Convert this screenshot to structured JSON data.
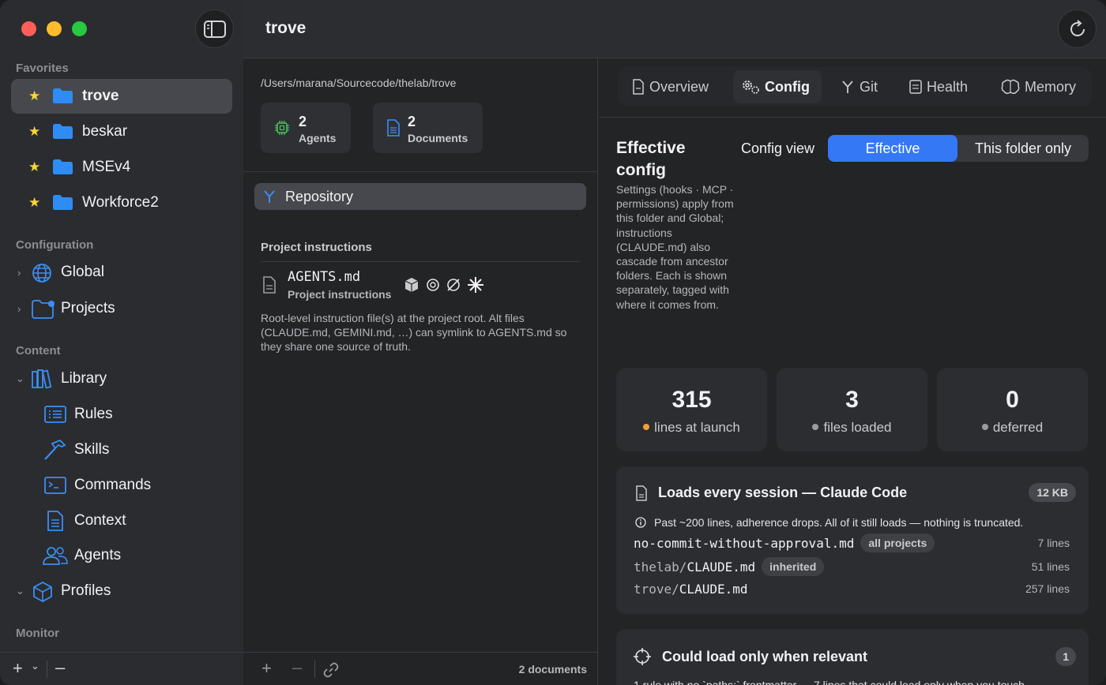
{
  "window": {
    "title": "trove"
  },
  "sidebar": {
    "favorites_header": "Favorites",
    "favorites": [
      {
        "label": "trove",
        "selected": true
      },
      {
        "label": "beskar",
        "selected": false
      },
      {
        "label": "MSEv4",
        "selected": false
      },
      {
        "label": "Workforce2",
        "selected": false
      }
    ],
    "configuration_header": "Configuration",
    "configuration": [
      {
        "label": "Global",
        "icon": "globe-icon"
      },
      {
        "label": "Projects",
        "icon": "folder-gear-icon"
      }
    ],
    "content_header": "Content",
    "library_label": "Library",
    "library_items": [
      {
        "label": "Rules",
        "icon": "list-icon"
      },
      {
        "label": "Skills",
        "icon": "hammer-icon"
      },
      {
        "label": "Commands",
        "icon": "terminal-icon"
      },
      {
        "label": "Context",
        "icon": "document-icon"
      },
      {
        "label": "Agents",
        "icon": "people-icon"
      }
    ],
    "profiles_label": "Profiles",
    "monitor_header": "Monitor"
  },
  "middle": {
    "path": "/Users/marana/Sourcecode/thelab/trove",
    "stats": [
      {
        "value": "2",
        "label": "Agents"
      },
      {
        "value": "2",
        "label": "Documents"
      }
    ],
    "repository_label": "Repository",
    "project_instructions_title": "Project instructions",
    "agents_file": "AGENTS.md",
    "agents_sub": "Project instructions",
    "description": "Root-level instruction file(s) at the project root. Alt files (CLAUDE.md, GEMINI.md, …) can symlink to AGENTS.md so they share one source of truth.",
    "doc_count": "2 documents"
  },
  "right": {
    "tabs": [
      {
        "label": "Overview",
        "active": false
      },
      {
        "label": "Config",
        "active": true
      },
      {
        "label": "Git",
        "active": false
      },
      {
        "label": "Health",
        "active": false
      },
      {
        "label": "Memory",
        "active": false
      }
    ],
    "title": "Effective config",
    "description": "Settings (hooks · MCP · permissions) apply from this folder and Global; instructions (CLAUDE.md) also cascade from ancestor folders. Each is shown separately, tagged with where it comes from.",
    "config_view_label": "Config view",
    "segments": {
      "on": "Effective",
      "off": "This folder only"
    },
    "metrics": [
      {
        "value": "315",
        "label": "lines at launch",
        "dot_color": "#f0a03c"
      },
      {
        "value": "3",
        "label": "files loaded",
        "dot_color": "#9a9ba0"
      },
      {
        "value": "0",
        "label": "deferred",
        "dot_color": "#9a9ba0"
      }
    ],
    "session_panel": {
      "title": "Loads every session — Claude Code",
      "size": "12 KB",
      "info": "Past ~200 lines, adherence drops. All of it still loads — nothing is truncated.",
      "files": [
        {
          "dim": "",
          "name": "no-commit-without-approval.md",
          "tag": "all projects",
          "lines": "7 lines"
        },
        {
          "dim": "thelab/",
          "name": "CLAUDE.md",
          "tag": "inherited",
          "lines": "51 lines"
        },
        {
          "dim": "trove/",
          "name": "CLAUDE.md",
          "tag": "",
          "lines": "257 lines"
        }
      ]
    },
    "relevant_panel": {
      "title": "Could load only when relevant",
      "count": "1",
      "text": "1 rule with no `paths:` frontmatter — 7 lines that could load only when you touch"
    }
  }
}
